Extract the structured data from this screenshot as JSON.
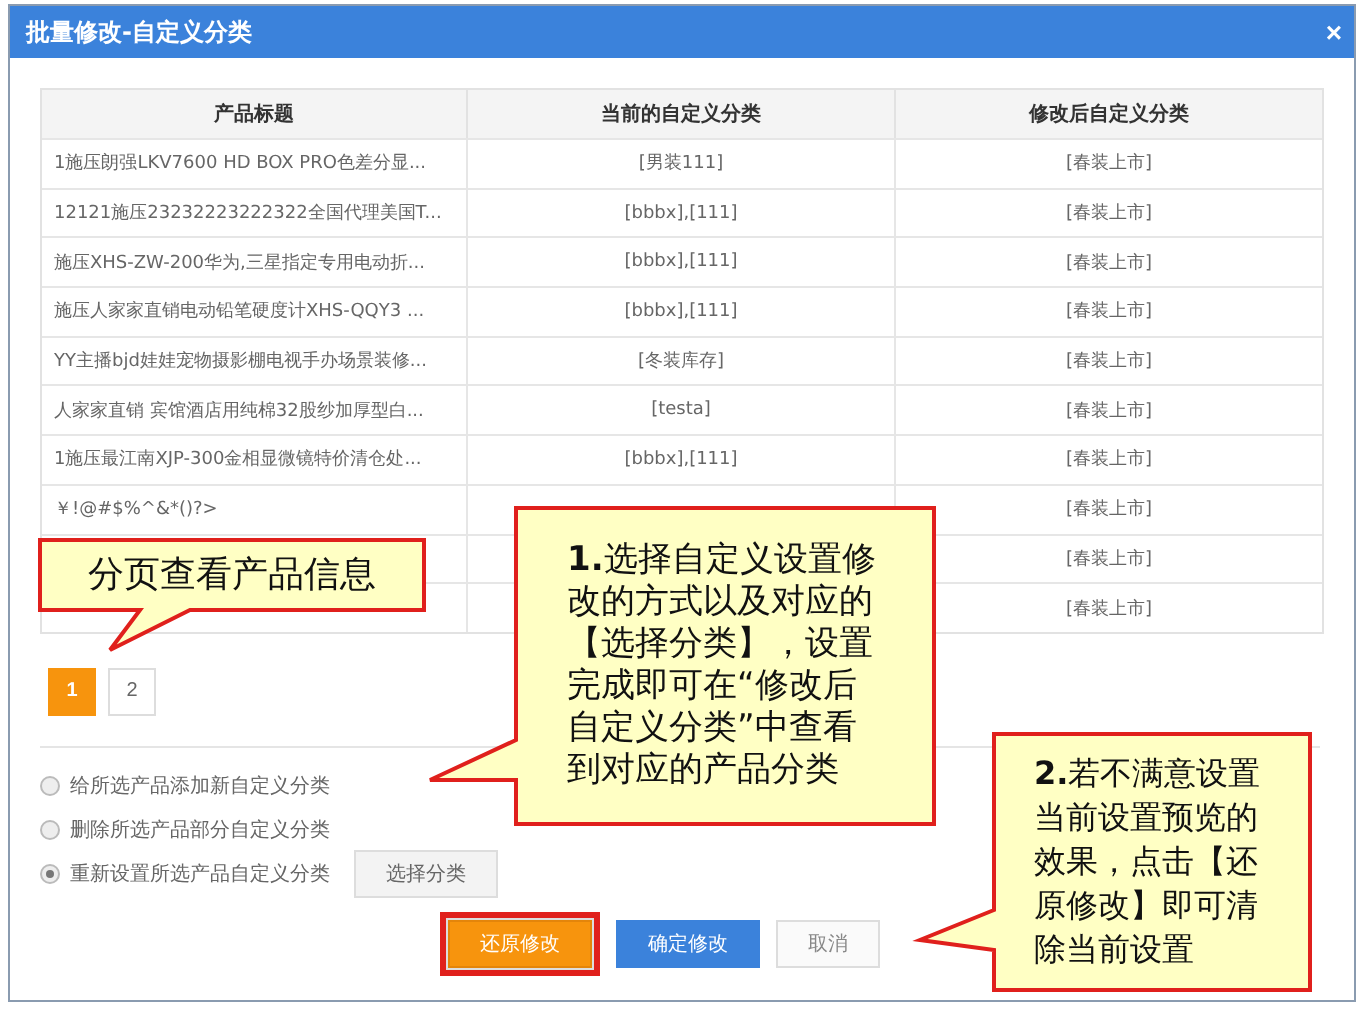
{
  "dialog": {
    "title": "批量修改-自定义分类",
    "close": "×"
  },
  "table": {
    "columns": [
      "产品标题",
      "当前的自定义分类",
      "修改后自定义分类"
    ],
    "rows": [
      {
        "title": "1施压朗强LKV7600 HD BOX PRO色差分显...",
        "current": "[男装111]",
        "modified": "[春装上市]"
      },
      {
        "title": "12121施压23232223222322全国代理美国T...",
        "current": "[bbbx],[111]",
        "modified": "[春装上市]"
      },
      {
        "title": "施压XHS-ZW-200华为,三星指定专用电动折...",
        "current": "[bbbx],[111]",
        "modified": "[春装上市]"
      },
      {
        "title": "施压人家家直销电动铅笔硬度计XHS-QQY3 ...",
        "current": "[bbbx],[111]",
        "modified": "[春装上市]"
      },
      {
        "title": "YY主播bjd娃娃宠物摄影棚电视手办场景装修...",
        "current": "[冬装库存]",
        "modified": "[春装上市]"
      },
      {
        "title": "人家家直销 宾馆酒店用纯棉32股纱加厚型白...",
        "current": "[testa]",
        "modified": "[春装上市]"
      },
      {
        "title": "1施压最江南XJP-300金相显微镜特价清仓处...",
        "current": "[bbbx],[111]",
        "modified": "[春装上市]"
      },
      {
        "title": "￥!@#$%^&*()?>",
        "modified": "[春装上市]"
      },
      {
        "modified": "[春装上市]"
      },
      {
        "modified": "[春装上市]"
      }
    ]
  },
  "pagination": [
    {
      "label": "1",
      "selected": true
    },
    {
      "label": "2",
      "selected": false
    }
  ],
  "options": [
    {
      "label": "给所选产品添加新自定义分类",
      "selected": false
    },
    {
      "label": "删除所选产品部分自定义分类",
      "selected": false
    },
    {
      "label": "重新设置所选产品自定义分类",
      "selected": true
    }
  ],
  "choose_button": "选择分类",
  "buttons": [
    {
      "label": "还原修改",
      "kind": "warning",
      "highlighted": true
    },
    {
      "label": "确定修改",
      "kind": "primary",
      "highlighted": false
    },
    {
      "label": "取消",
      "kind": "default",
      "highlighted": false
    }
  ],
  "callouts": [
    {
      "text": "分页查看产品信息"
    },
    {
      "text": "**1.**选择自定义设置修改的方式以及对应的【选择分类】，设置完成即可在“修改后自定义分类”中查看到对应的产品分类"
    },
    {
      "text": "**2.**若不满意设置当前设置预览的效果，点击【还原修改】即可清除当前设置"
    }
  ]
}
